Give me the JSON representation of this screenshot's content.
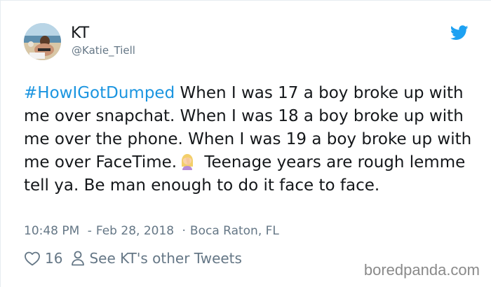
{
  "author": {
    "display_name": "KT",
    "handle": "@Katie_Tiell",
    "avatar_icon": "profile-photo-beach"
  },
  "brand": {
    "icon": "twitter-bird-icon",
    "color": "#1da1f2"
  },
  "tweet": {
    "hashtag": "#HowIGotDumped",
    "text_before_emoji": " When I was 17 a boy broke up with me over snapchat. When I was 18 a boy broke up with me over the phone. When I was 19 a boy broke up with me over FaceTime.",
    "emoji": "woman-facepalming",
    "text_after_emoji": " Teenage years are rough lemme tell ya. Be man enough to do it face to face.",
    "hashtag_color": "#1b95e0"
  },
  "meta": {
    "time": "10:48 PM",
    "date": "Feb 28, 2018",
    "location": "Boca Raton, FL",
    "separator_dash": "-",
    "separator_dot": "·"
  },
  "actions": {
    "like_icon": "heart-icon",
    "like_count": "16",
    "profile_icon": "person-icon",
    "other_tweets_label": "See KT's other Tweets"
  },
  "watermark": {
    "text": "boredpanda.com"
  },
  "colors": {
    "text": "#14171a",
    "secondary": "#657786",
    "border": "#e6ecf0"
  }
}
